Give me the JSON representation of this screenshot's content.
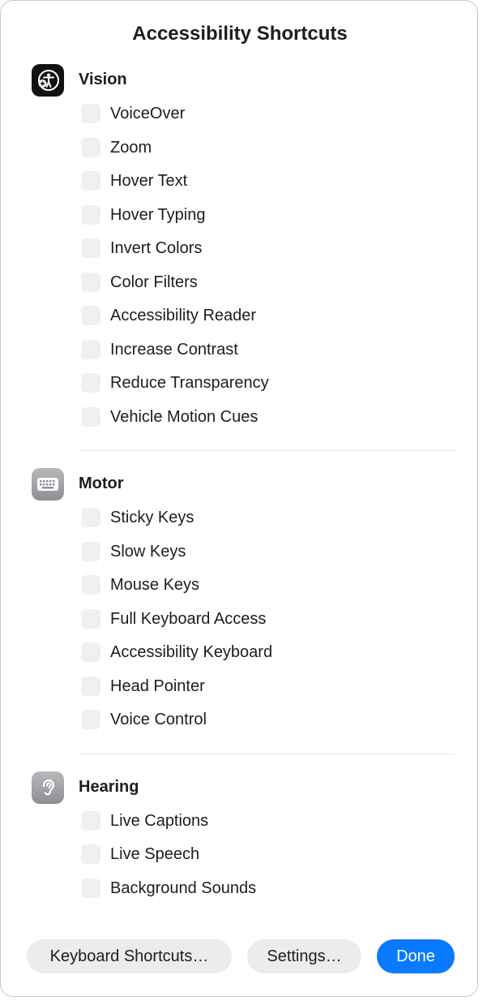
{
  "dialog": {
    "title": "Accessibility Shortcuts"
  },
  "sections": {
    "vision": {
      "title": "Vision",
      "icon": "accessibility-icon",
      "items": [
        "VoiceOver",
        "Zoom",
        "Hover Text",
        "Hover Typing",
        "Invert Colors",
        "Color Filters",
        "Accessibility Reader",
        "Increase Contrast",
        "Reduce Transparency",
        "Vehicle Motion Cues"
      ]
    },
    "motor": {
      "title": "Motor",
      "icon": "keyboard-icon",
      "items": [
        "Sticky Keys",
        "Slow Keys",
        "Mouse Keys",
        "Full Keyboard Access",
        "Accessibility Keyboard",
        "Head Pointer",
        "Voice Control"
      ]
    },
    "hearing": {
      "title": "Hearing",
      "icon": "ear-icon",
      "items": [
        "Live Captions",
        "Live Speech",
        "Background Sounds"
      ]
    }
  },
  "buttons": {
    "keyboard_shortcuts": "Keyboard Shortcuts…",
    "settings": "Settings…",
    "done": "Done"
  },
  "colors": {
    "accent": "#0a7aff",
    "checkbox_bg": "#f0f0f2"
  }
}
